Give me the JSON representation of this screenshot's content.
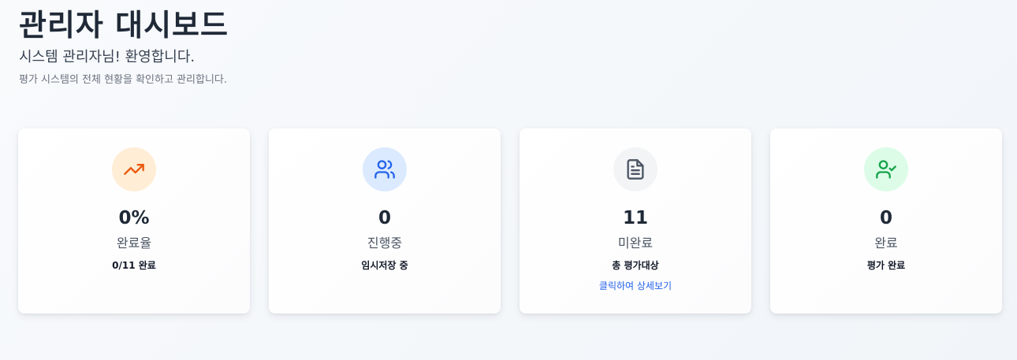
{
  "header": {
    "title": "관리자 대시보드",
    "welcome": "시스템 관리자님! 환영합니다.",
    "subtitle": "평가 시스템의 전체 현황을 확인하고 관리합니다."
  },
  "cards": [
    {
      "icon": "trending-up-icon",
      "value": "0%",
      "label": "완료율",
      "sub": "0/11 완료",
      "icon_bg": "#ffedd5",
      "icon_color": "#ea580c"
    },
    {
      "icon": "users-icon",
      "value": "0",
      "label": "진행중",
      "sub": "임시저장 중",
      "icon_bg": "#dbeafe",
      "icon_color": "#2563eb"
    },
    {
      "icon": "document-icon",
      "value": "11",
      "label": "미완료",
      "sub": "총 평가대상",
      "link": "클릭하여 상세보기",
      "icon_bg": "#f3f4f6",
      "icon_color": "#4b5563"
    },
    {
      "icon": "user-check-icon",
      "value": "0",
      "label": "완료",
      "sub": "평가 완료",
      "icon_bg": "#dcfce7",
      "icon_color": "#16a34a"
    }
  ],
  "colors": {
    "link": "#2563eb",
    "title": "#1f2937"
  }
}
